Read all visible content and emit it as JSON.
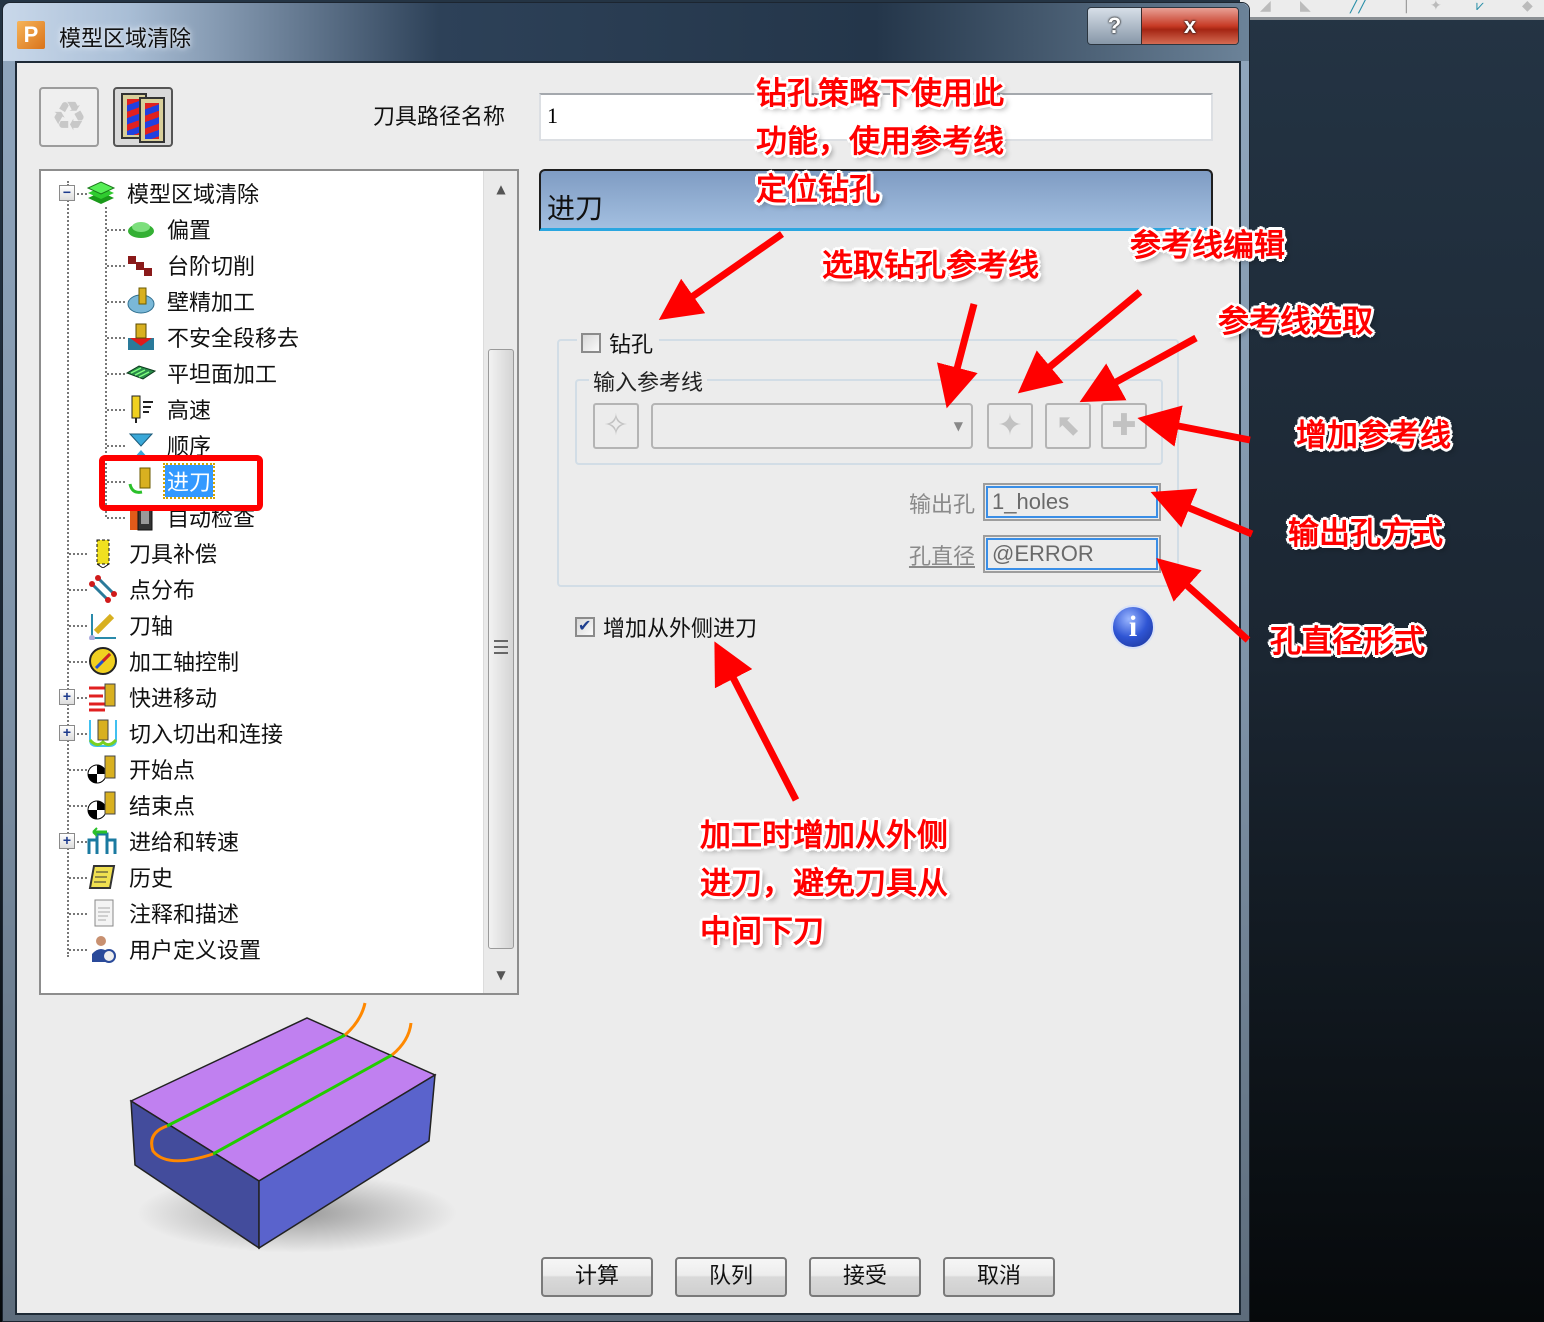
{
  "window": {
    "title": "模型区域清除",
    "app_icon_letter": "P",
    "help_label": "?",
    "close_label": "x"
  },
  "toolbar": {
    "toolpath_name_label": "刀具路径名称",
    "toolpath_name_value": "1"
  },
  "tree": {
    "root": {
      "label": "模型区域清除",
      "expanded": true
    },
    "children": [
      {
        "label": "偏置"
      },
      {
        "label": "台阶切削"
      },
      {
        "label": "壁精加工"
      },
      {
        "label": "不安全段移去"
      },
      {
        "label": "平坦面加工"
      },
      {
        "label": "高速"
      },
      {
        "label": "顺序"
      },
      {
        "label": "进刀",
        "selected": true
      },
      {
        "label": "自动检查"
      }
    ],
    "siblings": [
      {
        "label": "刀具补偿"
      },
      {
        "label": "点分布"
      },
      {
        "label": "刀轴"
      },
      {
        "label": "加工轴控制"
      },
      {
        "label": "快进移动",
        "expandable": true
      },
      {
        "label": "切入切出和连接",
        "expandable": true
      },
      {
        "label": "开始点"
      },
      {
        "label": "结束点"
      },
      {
        "label": "进给和转速",
        "expandable": true
      },
      {
        "label": "历史"
      },
      {
        "label": "注释和描述"
      },
      {
        "label": "用户定义设置"
      }
    ],
    "scroll_up": "▲",
    "scroll_down": "▼"
  },
  "page": {
    "header": "进刀",
    "drill": {
      "label": "钻孔",
      "checked": false
    },
    "input_reference": {
      "group_label": "输入参考线",
      "combo_value": "",
      "combo_arrow": "▼"
    },
    "output_holes": {
      "label": "输出孔",
      "value": "1_holes"
    },
    "hole_diameter": {
      "label": "孔直径",
      "value": "@ERROR"
    },
    "add_outside_lead_in": {
      "label": "增加从外侧进刀",
      "checked": true
    },
    "info_glyph": "i"
  },
  "buttons": {
    "calculate": "计算",
    "queue": "队列",
    "accept": "接受",
    "cancel": "取消"
  },
  "annotations": {
    "drill_note": [
      "钻孔策略下使用此",
      "功能，使用参考线",
      "定位钻孔"
    ],
    "select_ref": "选取钻孔参考线",
    "ref_edit": "参考线编辑",
    "ref_pick": "参考线选取",
    "add_ref": "增加参考线",
    "output_mode": "输出孔方式",
    "diameter_mode": "孔直径形式",
    "outside_note": [
      "加工时增加从外侧",
      "进刀，避免刀具从",
      "中间下刀"
    ]
  },
  "colors": {
    "annotation_red": "#ff0000",
    "selection_blue": "#3399ff",
    "header_blue": "#8fb0d8",
    "preview_top": "#c080f0",
    "preview_side": "#5a63cc",
    "toolpath_green": "#22cc00",
    "lead_orange": "#ff8800"
  }
}
